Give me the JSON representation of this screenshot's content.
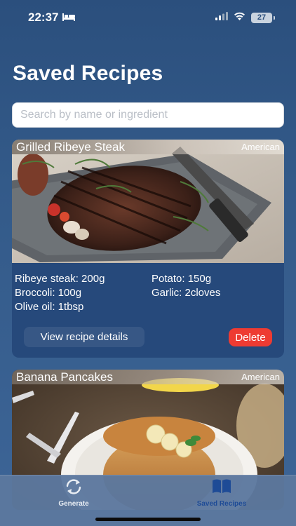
{
  "status_bar": {
    "time": "22:37",
    "sleep_icon": "bed-icon",
    "battery_level": "27",
    "signal_icon": "cellular-signal-icon",
    "wifi_icon": "wifi-icon"
  },
  "page": {
    "title": "Saved Recipes"
  },
  "search": {
    "placeholder": "Search by name or ingredient",
    "value": ""
  },
  "recipes": [
    {
      "name": "Grilled Ribeye Steak",
      "cuisine": "American",
      "ingredients": [
        "Ribeye steak: 200g",
        "Potato: 150g",
        "Broccoli: 100g",
        "Garlic: 2cloves",
        "Olive oil: 1tbsp"
      ],
      "details_label": "View recipe details",
      "delete_label": "Delete"
    },
    {
      "name": "Banana Pancakes",
      "cuisine": "American"
    }
  ],
  "tab_bar": {
    "tabs": [
      {
        "label": "Generate",
        "icon": "refresh-icon",
        "active": false
      },
      {
        "label": "Saved Recipes",
        "icon": "book-icon",
        "active": true
      }
    ]
  },
  "colors": {
    "background": "#335a89",
    "card": "#25487a",
    "delete": "#ee3b32",
    "active_tab": "#1e4b96"
  }
}
